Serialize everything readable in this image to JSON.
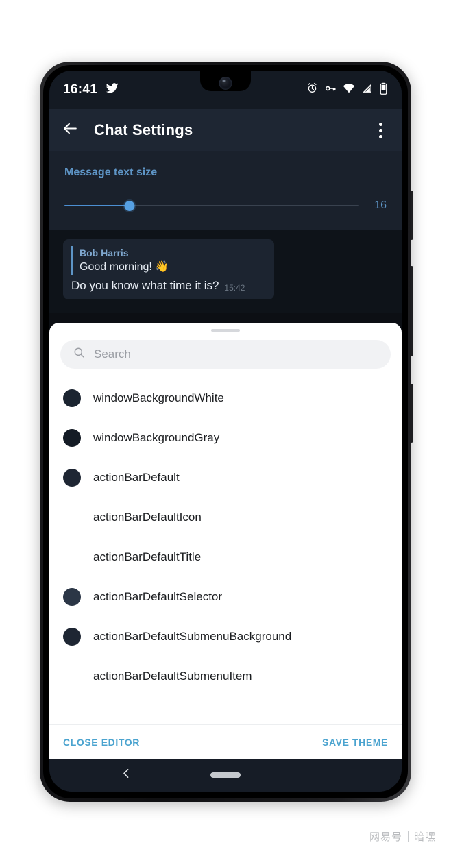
{
  "status_bar": {
    "time": "16:41",
    "left_icons": [
      "twitter-icon"
    ],
    "right_icons": [
      "alarm-icon",
      "vpn-key-icon",
      "wifi-icon",
      "signal-icon",
      "battery-icon"
    ]
  },
  "action_bar": {
    "back_icon": "arrow-back-icon",
    "title": "Chat Settings",
    "overflow_icon": "more-vert-icon"
  },
  "settings": {
    "text_size_label": "Message text size",
    "text_size_value": "16",
    "slider_percent": 22,
    "accent_color": "#5e95c6"
  },
  "chat_preview": {
    "reply_name": "Bob Harris",
    "reply_text": "Good morning! 👋",
    "message_text": "Do you know what time it is?",
    "message_time": "15:42"
  },
  "sheet": {
    "search": {
      "placeholder": "Search",
      "value": "",
      "icon": "search-icon"
    },
    "items": [
      {
        "label": "windowBackgroundWhite",
        "color": "#1b2430",
        "has_swatch": true
      },
      {
        "label": "windowBackgroundGray",
        "color": "#141b25",
        "has_swatch": true
      },
      {
        "label": "actionBarDefault",
        "color": "#1e2633",
        "has_swatch": true
      },
      {
        "label": "actionBarDefaultIcon",
        "color": "#ffffff",
        "has_swatch": false
      },
      {
        "label": "actionBarDefaultTitle",
        "color": "#ffffff",
        "has_swatch": false
      },
      {
        "label": "actionBarDefaultSelector",
        "color": "#2b3646",
        "has_swatch": true
      },
      {
        "label": "actionBarDefaultSubmenuBackground",
        "color": "#1e2633",
        "has_swatch": true
      },
      {
        "label": "actionBarDefaultSubmenuItem",
        "color": "#ffffff",
        "has_swatch": false
      }
    ],
    "close_button": "CLOSE EDITOR",
    "save_button": "SAVE THEME",
    "button_color": "#4aa3cf"
  },
  "nav_bar": {
    "back_icon": "chevron-left-icon",
    "home_icon": "home-pill-indicator"
  },
  "watermark": {
    "brand": "网易号",
    "account": "暗嘿"
  }
}
